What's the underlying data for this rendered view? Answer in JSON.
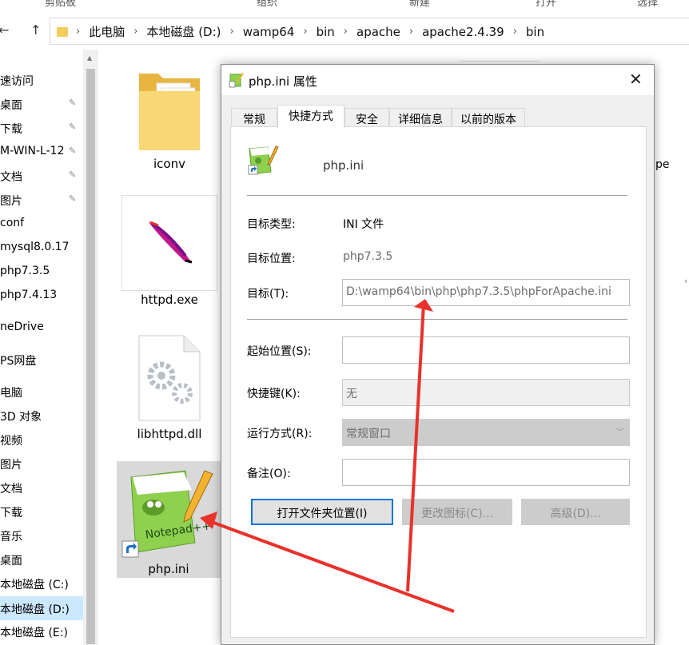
{
  "ribbon": {
    "groups": [
      "剪贴板",
      "组织",
      "新建",
      "打开",
      "选择"
    ]
  },
  "address": {
    "back_glyph": "←",
    "up_glyph": "↑",
    "crumbs": [
      "此电脑",
      "本地磁盘 (D:)",
      "wamp64",
      "bin",
      "apache",
      "apache2.4.39",
      "bin"
    ]
  },
  "nav": {
    "items": [
      {
        "label": "速访问",
        "pinned": false
      },
      {
        "label": "桌面",
        "pinned": true
      },
      {
        "label": "下载",
        "pinned": true
      },
      {
        "label": "M-WIN-L-12",
        "pinned": true
      },
      {
        "label": "文档",
        "pinned": true
      },
      {
        "label": "图片",
        "pinned": true
      },
      {
        "label": "conf",
        "pinned": false
      },
      {
        "label": "mysql8.0.17",
        "pinned": false
      },
      {
        "label": "php7.3.5",
        "pinned": false
      },
      {
        "label": "php7.4.13",
        "pinned": false
      },
      {
        "label": "neDrive",
        "pinned": false
      },
      {
        "label": "PS网盘",
        "pinned": false
      },
      {
        "label": "电脑",
        "pinned": false
      },
      {
        "label": "3D 对象",
        "pinned": false
      },
      {
        "label": "视频",
        "pinned": false
      },
      {
        "label": "图片",
        "pinned": false
      },
      {
        "label": "文档",
        "pinned": false
      },
      {
        "label": "下载",
        "pinned": false
      },
      {
        "label": "音乐",
        "pinned": false
      },
      {
        "label": "桌面",
        "pinned": false
      },
      {
        "label": "本地磁盘 (C:)",
        "pinned": false
      },
      {
        "label": "本地磁盘 (D:)",
        "pinned": false,
        "selected": true
      },
      {
        "label": "本地磁盘 (E:)",
        "pinned": false
      }
    ],
    "pin_glyph": "📌"
  },
  "files": {
    "iconv": "iconv",
    "httpd": "httpd.exe",
    "libhttpd": "libhttpd.dll",
    "phpini": "php.ini",
    "right_cut": "pe"
  },
  "dialog": {
    "title": "php.ini 属性",
    "close_glyph": "✕",
    "tabs": [
      "常规",
      "快捷方式",
      "安全",
      "详细信息",
      "以前的版本"
    ],
    "active_tab": 1,
    "file_name": "php.ini",
    "target_type_label": "目标类型:",
    "target_type_value": "INI 文件",
    "target_location_label": "目标位置:",
    "target_location_value": "php7.3.5",
    "target_label": "目标(T):",
    "target_value": "D:\\wamp64\\bin\\php\\php7.3.5\\phpForApache.ini",
    "start_in_label": "起始位置(S):",
    "start_in_value": "",
    "hotkey_label": "快捷键(K):",
    "hotkey_value": "无",
    "run_label": "运行方式(R):",
    "run_value": "常规窗口",
    "comment_label": "备注(O):",
    "comment_value": "",
    "btn_open_location": "打开文件夹位置(I)",
    "btn_change_icon": "更改图标(C)...",
    "btn_advanced": "高级(D)..."
  },
  "colors": {
    "selection": "#cce8ff",
    "focus_border": "#0078d7",
    "arrow": "#e8322b",
    "folder": "#f3cd5c"
  }
}
